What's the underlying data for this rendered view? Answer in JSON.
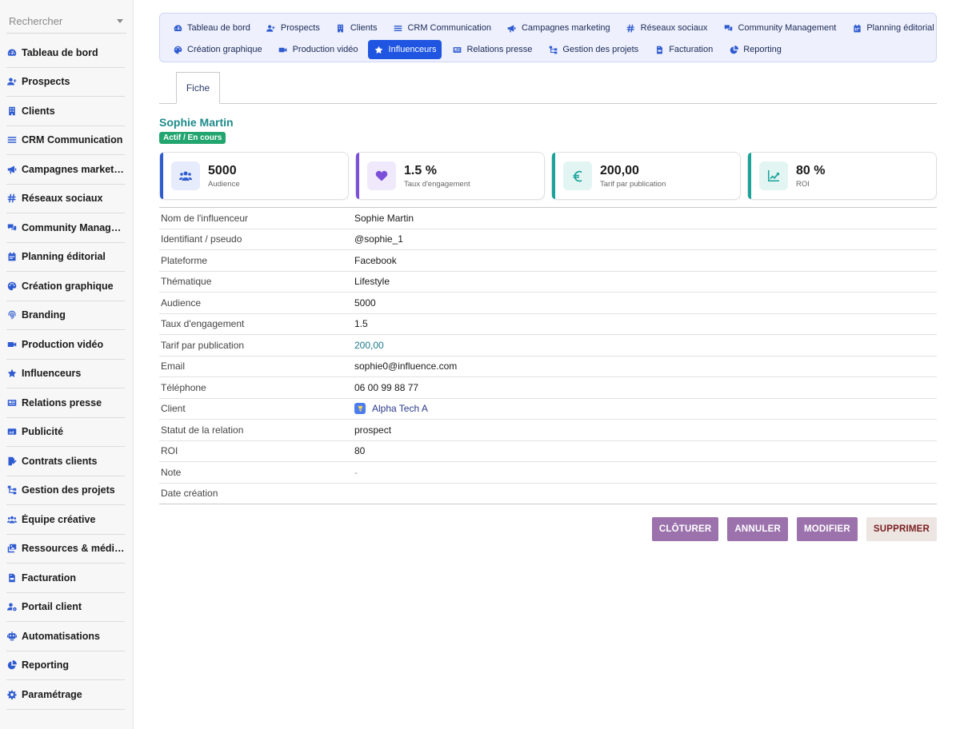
{
  "sidebar": {
    "search_placeholder": "Rechercher",
    "items": [
      {
        "label": "Tableau de bord",
        "icon": "gauge-icon"
      },
      {
        "label": "Prospects",
        "icon": "user-plus-icon"
      },
      {
        "label": "Clients",
        "icon": "building-icon"
      },
      {
        "label": "CRM Communication",
        "icon": "bars-icon"
      },
      {
        "label": "Campagnes marketing",
        "icon": "bullhorn-icon"
      },
      {
        "label": "Réseaux sociaux",
        "icon": "hashtag-icon"
      },
      {
        "label": "Community Manage…",
        "icon": "comments-icon"
      },
      {
        "label": "Planning éditorial",
        "icon": "calendar-icon"
      },
      {
        "label": "Création graphique",
        "icon": "palette-icon"
      },
      {
        "label": "Branding",
        "icon": "fingerprint-icon"
      },
      {
        "label": "Production vidéo",
        "icon": "video-icon"
      },
      {
        "label": "Influenceurs",
        "icon": "star-icon"
      },
      {
        "label": "Relations presse",
        "icon": "newspaper-icon"
      },
      {
        "label": "Publicité",
        "icon": "ad-icon"
      },
      {
        "label": "Contrats clients",
        "icon": "file-signature-icon"
      },
      {
        "label": "Gestion des projets",
        "icon": "sitemap-icon"
      },
      {
        "label": "Équipe créative",
        "icon": "users-icon"
      },
      {
        "label": "Ressources & médias",
        "icon": "photo-video-icon"
      },
      {
        "label": "Facturation",
        "icon": "file-invoice-icon"
      },
      {
        "label": "Portail client",
        "icon": "user-gear-icon"
      },
      {
        "label": "Automatisations",
        "icon": "robot-icon"
      },
      {
        "label": "Reporting",
        "icon": "chart-pie-icon"
      },
      {
        "label": "Paramétrage",
        "icon": "gear-icon"
      }
    ]
  },
  "topnav": {
    "row1": [
      {
        "label": "Tableau de bord",
        "icon": "gauge-icon"
      },
      {
        "label": "Prospects",
        "icon": "user-plus-icon"
      },
      {
        "label": "Clients",
        "icon": "building-icon"
      },
      {
        "label": "CRM Communication",
        "icon": "bars-icon"
      },
      {
        "label": "Campagnes marketing",
        "icon": "bullhorn-icon"
      },
      {
        "label": "Réseaux sociaux",
        "icon": "hashtag-icon"
      },
      {
        "label": "Community Management",
        "icon": "comments-icon"
      },
      {
        "label": "Planning éditorial",
        "icon": "calendar-icon"
      }
    ],
    "row2": [
      {
        "label": "Création graphique",
        "icon": "palette-icon"
      },
      {
        "label": "Production vidéo",
        "icon": "video-icon"
      },
      {
        "label": "Influenceurs",
        "icon": "star-icon",
        "active": true
      },
      {
        "label": "Relations presse",
        "icon": "newspaper-icon"
      },
      {
        "label": "Gestion des projets",
        "icon": "sitemap-icon"
      },
      {
        "label": "Facturation",
        "icon": "file-invoice-icon"
      },
      {
        "label": "Reporting",
        "icon": "chart-pie-icon"
      }
    ]
  },
  "tabs": {
    "fiche": "Fiche"
  },
  "header": {
    "name": "Sophie Martin",
    "status": "Actif / En cours"
  },
  "kpis": [
    {
      "value": "5000",
      "label": "Audience",
      "icon": "users-icon",
      "accent": "#2f5bd0",
      "bg": "#e6ecfb",
      "icon_color": "#2f5bd0"
    },
    {
      "value": "1.5 %",
      "label": "Taux d'engagement",
      "icon": "heart-icon",
      "accent": "#7b4fd8",
      "bg": "#efe9fb",
      "icon_color": "#7b4fd8"
    },
    {
      "value": "200,00",
      "label": "Tarif par publication",
      "icon": "euro-icon",
      "accent": "#1aa39a",
      "bg": "#e3f5f3",
      "icon_color": "#1aa39a"
    },
    {
      "value": "80 %",
      "label": "ROI",
      "icon": "chart-line-icon",
      "accent": "#1aa39a",
      "bg": "#e3f5f3",
      "icon_color": "#1aa39a"
    }
  ],
  "details": {
    "nom_label": "Nom de l'influenceur",
    "nom": "Sophie Martin",
    "pseudo_label": "Identifiant / pseudo",
    "pseudo": "@sophie_1",
    "plateforme_label": "Plateforme",
    "plateforme": "Facebook",
    "thematique_label": "Thématique",
    "thematique": "Lifestyle",
    "audience_label": "Audience",
    "audience": "5000",
    "taux_label": "Taux d'engagement",
    "taux": "1.5",
    "tarif_label": "Tarif par publication",
    "tarif": "200,00",
    "email_label": "Email",
    "email": "sophie0@influence.com",
    "tel_label": "Téléphone",
    "tel": "06 00 99 88 77",
    "client_label": "Client",
    "client": "Alpha Tech A",
    "statut_label": "Statut de la relation",
    "statut": "prospect",
    "roi_label": "ROI",
    "roi": "80",
    "note_label": "Note",
    "note": "-",
    "date_label": "Date création",
    "date": ""
  },
  "actions": {
    "cloturer": "CLÔTURER",
    "annuler": "ANNULER",
    "modifier": "MODIFIER",
    "supprimer": "SUPPRIMER"
  }
}
